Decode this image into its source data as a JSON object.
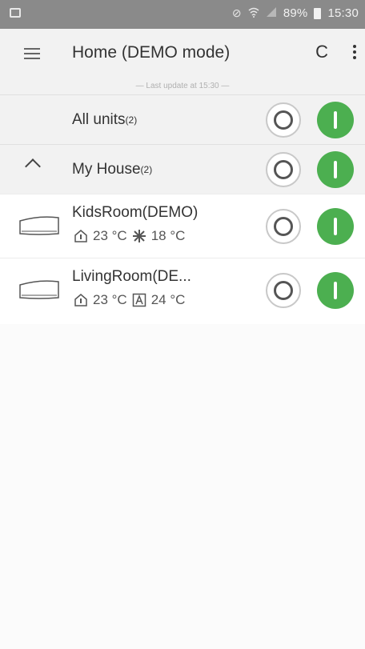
{
  "status_bar": {
    "battery": "89%",
    "time": "15:30"
  },
  "app_bar": {
    "title": "Home (DEMO mode)"
  },
  "last_update": "— Last update at 15:30 —",
  "groups": [
    {
      "label": "All units",
      "count": "(2)"
    },
    {
      "label": "My House",
      "count": "(2)"
    }
  ],
  "units": [
    {
      "name": "KidsRoom(DEMO)",
      "indoor_temp": "23 °C",
      "mode_icon": "snowflake-icon",
      "set_temp": "18 °C"
    },
    {
      "name": "LivingRoom(DE...",
      "indoor_temp": "23 °C",
      "mode_icon": "auto-mode-icon",
      "set_temp": "24 °C"
    }
  ],
  "colors": {
    "power_on": "#4caf50",
    "status_bar": "#8a8a8a",
    "header_bg": "#f2f2f2"
  }
}
